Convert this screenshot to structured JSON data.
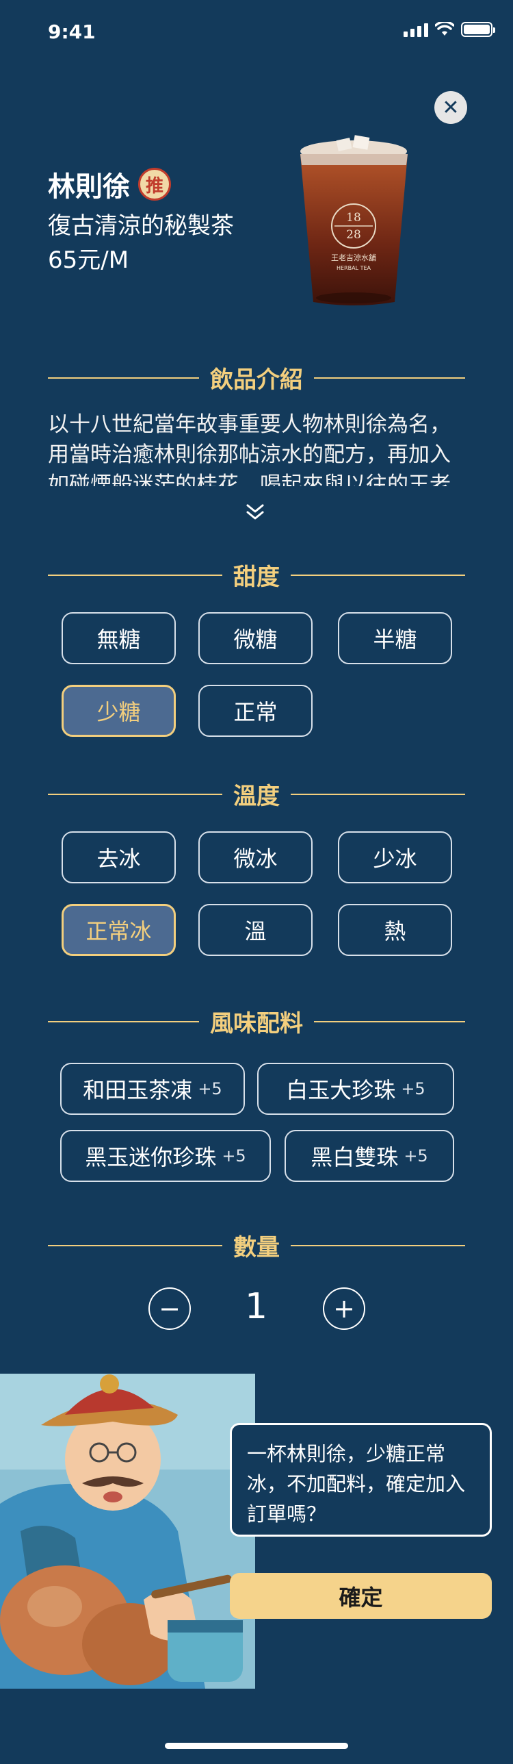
{
  "status_bar": {
    "time": "9:41"
  },
  "close_icon": "close-icon",
  "product": {
    "name": "林則徐",
    "badge": "推",
    "subtitle": "復古清涼的秘製茶",
    "price": "65元/M",
    "cup_label_top": "18",
    "cup_label_bottom": "28",
    "cup_brand": "王老吉涼水舖",
    "cup_brand_en": "HERBAL TEA"
  },
  "intro": {
    "title": "飲品介紹",
    "text": "以十八世紀當年故事重要人物林則徐為名，用當時治癒林則徐那帖涼水的配方，再加入如碰煙般迷茫的桂花，喝起來與以往的王老"
  },
  "sweetness": {
    "title": "甜度",
    "options": [
      "無糖",
      "微糖",
      "半糖",
      "少糖",
      "正常"
    ],
    "selected": "少糖"
  },
  "temperature": {
    "title": "溫度",
    "options": [
      "去冰",
      "微冰",
      "少冰",
      "正常冰",
      "溫",
      "熱"
    ],
    "selected": "正常冰"
  },
  "toppings": {
    "title": "風味配料",
    "items": [
      {
        "label": "和田玉茶凍",
        "price": "+5"
      },
      {
        "label": "白玉大珍珠",
        "price": "+5"
      },
      {
        "label": "黑玉迷你珍珠",
        "price": "+5"
      },
      {
        "label": "黑白雙珠",
        "price": "+5"
      }
    ]
  },
  "quantity": {
    "title": "數量",
    "value": "1",
    "minus": "−",
    "plus": "+"
  },
  "confirm_bubble": {
    "text": "一杯林則徐，少糖正常冰，不加配料，確定加入訂單嗎？"
  },
  "confirm_button": {
    "label": "確定"
  },
  "colors": {
    "background": "#133a5b",
    "accent_gold": "#f3cf7e",
    "selected_fill": "#4c6a91",
    "button_fill": "#f5d38b"
  }
}
